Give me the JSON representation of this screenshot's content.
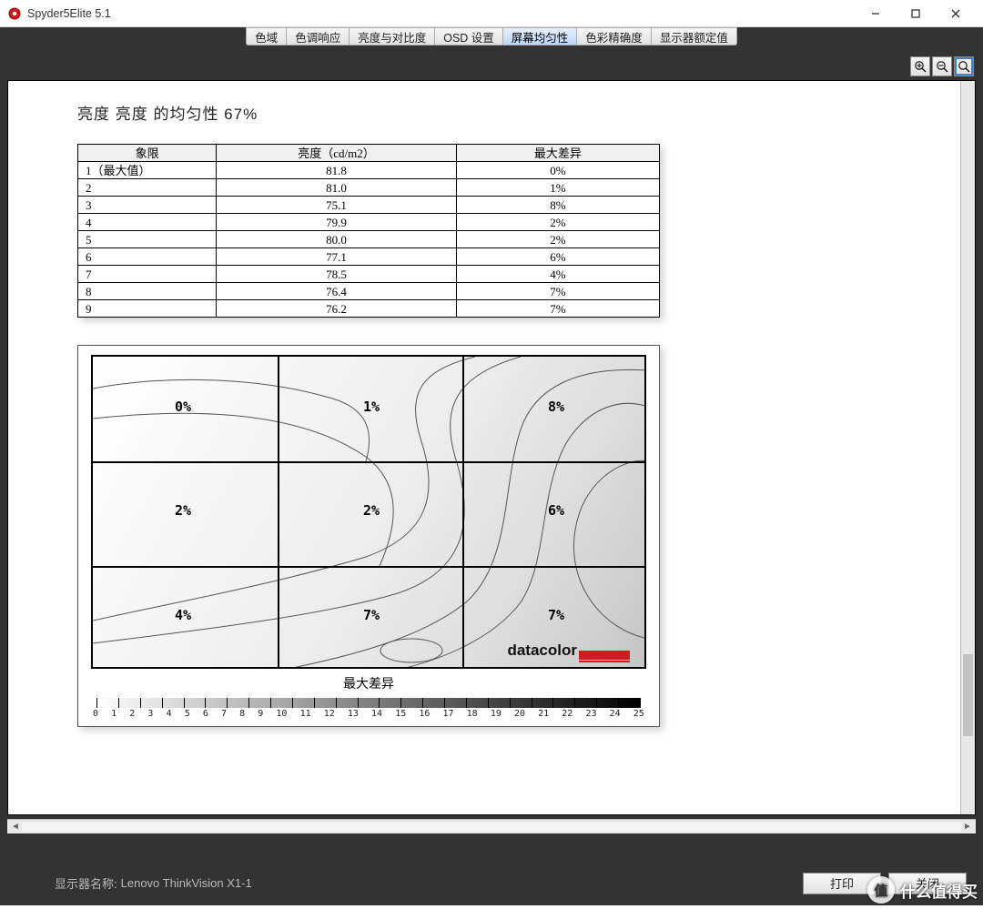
{
  "window": {
    "title": "Spyder5Elite 5.1"
  },
  "tabs": [
    "色域",
    "色调响应",
    "亮度与对比度",
    "OSD 设置",
    "屏幕均匀性",
    "色彩精确度",
    "显示器额定值"
  ],
  "active_tab_index": 4,
  "page": {
    "heading": "亮度  亮度  的均匀性  67%"
  },
  "table": {
    "headers": [
      "象限",
      "亮度（cd/m2）",
      "最大差异"
    ],
    "rows": [
      {
        "idx": "1（最大值）",
        "lum": "81.8",
        "dev": "0%"
      },
      {
        "idx": "2",
        "lum": "81.0",
        "dev": "1%"
      },
      {
        "idx": "3",
        "lum": "75.1",
        "dev": "8%"
      },
      {
        "idx": "4",
        "lum": "79.9",
        "dev": "2%"
      },
      {
        "idx": "5",
        "lum": "80.0",
        "dev": "2%"
      },
      {
        "idx": "6",
        "lum": "77.1",
        "dev": "6%"
      },
      {
        "idx": "7",
        "lum": "78.5",
        "dev": "4%"
      },
      {
        "idx": "8",
        "lum": "76.4",
        "dev": "7%"
      },
      {
        "idx": "9",
        "lum": "76.2",
        "dev": "7%"
      }
    ]
  },
  "chart_data": {
    "type": "heatmap",
    "title": "最大差异",
    "grid_labels": [
      [
        "0%",
        "1%",
        "8%"
      ],
      [
        "2%",
        "2%",
        "6%"
      ],
      [
        "4%",
        "7%",
        "7%"
      ]
    ],
    "scale": {
      "min": 0,
      "max": 25,
      "ticks": [
        0,
        1,
        2,
        3,
        4,
        5,
        6,
        7,
        8,
        9,
        10,
        11,
        12,
        13,
        14,
        15,
        16,
        17,
        18,
        19,
        20,
        21,
        22,
        23,
        24,
        25
      ]
    },
    "brand": "datacolor"
  },
  "footer": {
    "monitor_label": "显示器名称:",
    "monitor_name": "Lenovo ThinkVision X1-1",
    "print": "打印",
    "close": "关闭"
  },
  "watermark": {
    "badge": "值",
    "text": "什么值得买"
  }
}
